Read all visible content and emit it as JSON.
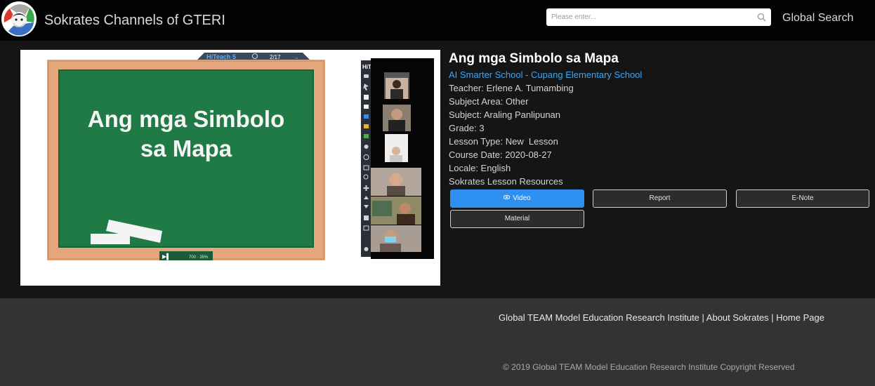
{
  "header": {
    "site_title": "Sokrates Channels of GTERI",
    "search_placeholder": "Please enter...",
    "global_search_label": "Global Search",
    "search_icon": "magnifier-icon"
  },
  "video": {
    "board_line1": "Ang mga Simbolo",
    "board_line2": "sa Mapa",
    "toolbar_brand": "HiTeach 5",
    "toolbar_page": "2/17",
    "toolbar_label": "HiT",
    "participant_count": 6
  },
  "lesson": {
    "title": "Ang mga Simbolo sa Mapa",
    "school": "AI Smarter School - Cupang Elementary School",
    "meta": [
      "Teacher: Erlene A. Tumambing",
      "Subject Area: Other",
      "Subject: Araling Panlipunan",
      "Grade: 3",
      "Lesson Type: New  Lesson",
      "Course Date: 2020-08-27",
      "Locale: English"
    ],
    "resources_title": "Sokrates Lesson Resources"
  },
  "buttons": {
    "video": "Video",
    "report": "Report",
    "enote": "E-Note",
    "material": "Material",
    "video_icon": "eye-icon"
  },
  "footer": {
    "link1": "Global TEAM Model Education Research Institute",
    "link2": "About Sokrates",
    "link3": "Home Page",
    "separator": " | ",
    "copyright": "© 2019 Global TEAM Model Education Research Institute Copyright Reserved"
  },
  "colors": {
    "header_bg": "#030303",
    "main_bg": "#151515",
    "footer_bg": "#333333",
    "accent_blue": "#2d8ff0",
    "link_blue": "#3fa6f2",
    "board_green": "#1f7a45",
    "board_frame": "#e3a77b"
  }
}
